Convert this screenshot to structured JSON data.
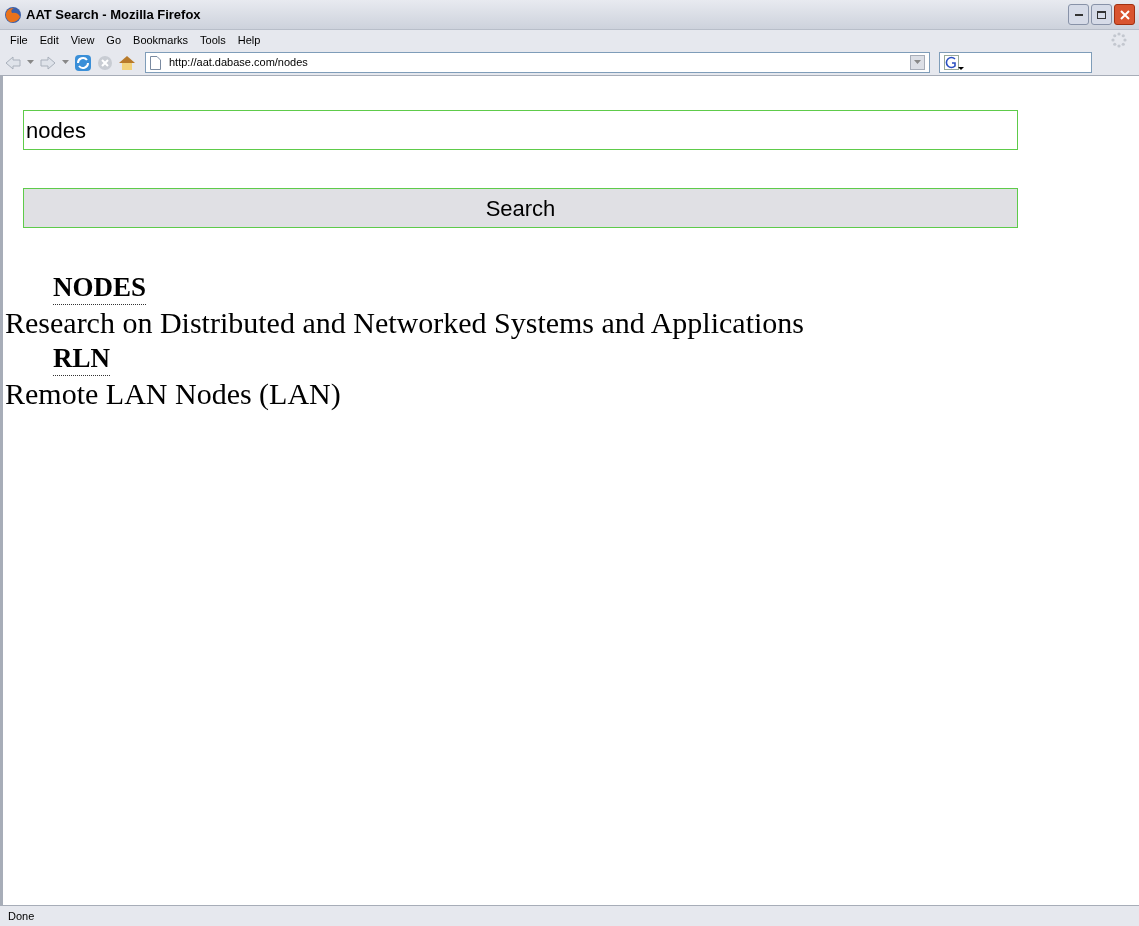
{
  "window": {
    "title": "AAT Search - Mozilla Firefox"
  },
  "menu": [
    "File",
    "Edit",
    "View",
    "Go",
    "Bookmarks",
    "Tools",
    "Help"
  ],
  "address_bar": {
    "value": "http://aat.dabase.com/nodes"
  },
  "search": {
    "value": "nodes",
    "button": "Search"
  },
  "results": [
    {
      "term": "NODES",
      "definition": "Research on Distributed and Networked Systems and Applications"
    },
    {
      "term": "RLN",
      "definition": "Remote LAN Nodes (LAN)"
    }
  ],
  "status_bar": "Done"
}
